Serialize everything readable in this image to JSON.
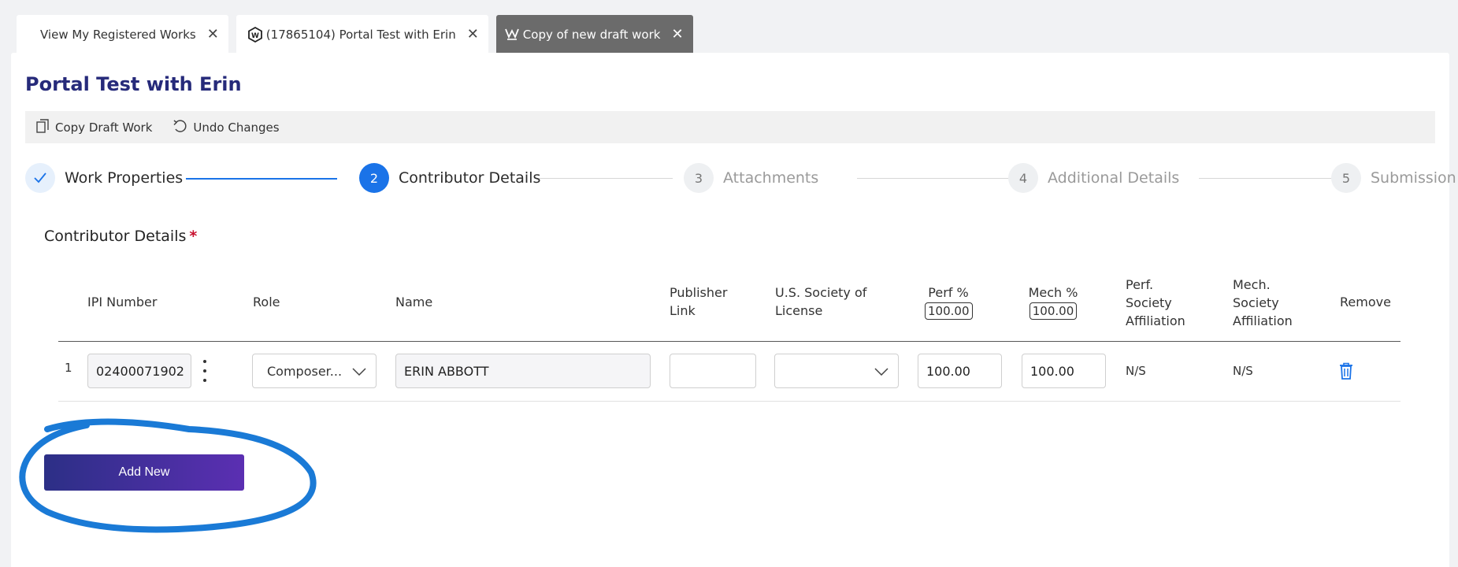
{
  "tabs": [
    {
      "label": "View My Registered Works",
      "icon": "none"
    },
    {
      "label": "(17865104) Portal Test with Erin",
      "icon": "work-logo-icon"
    },
    {
      "label": "Copy of new draft work",
      "icon": "draft-copy-icon",
      "active": true
    }
  ],
  "page": {
    "title": "Portal Test with Erin"
  },
  "toolbar": {
    "copy_label": "Copy Draft Work",
    "undo_label": "Undo Changes"
  },
  "stepper": {
    "steps": [
      {
        "number": "1",
        "label": "Work Properties",
        "state": "done"
      },
      {
        "number": "2",
        "label": "Contributor Details",
        "state": "active"
      },
      {
        "number": "3",
        "label": "Attachments",
        "state": "pending"
      },
      {
        "number": "4",
        "label": "Additional Details",
        "state": "pending"
      },
      {
        "number": "5",
        "label": "Submission",
        "state": "pending"
      }
    ]
  },
  "section": {
    "title": "Contributor Details",
    "required_mark": "*"
  },
  "table": {
    "headers": {
      "ipi": "IPI Number",
      "role": "Role",
      "name": "Name",
      "publisher_link": "Publisher Link",
      "society": "U.S. Society of License",
      "perf": "Perf %",
      "perf_total": "100.00",
      "mech": "Mech %",
      "mech_total": "100.00",
      "perf_aff": "Perf. Society Affiliation",
      "mech_aff": "Mech. Society Affiliation",
      "remove": "Remove"
    },
    "rows": [
      {
        "index": "1",
        "ipi": "02400071902",
        "role": "Composer...",
        "name": "ERIN ABBOTT",
        "publisher_link": "",
        "society": "",
        "perf": "100.00",
        "mech": "100.00",
        "perf_aff": "N/S",
        "mech_aff": "N/S"
      }
    ]
  },
  "actions": {
    "add_new_label": "Add New"
  },
  "colors": {
    "accent": "#1a73e8",
    "title": "#262a7a",
    "button_start": "#2c2f86",
    "button_end": "#5b2fb2",
    "annotation": "#1a7ad6"
  }
}
